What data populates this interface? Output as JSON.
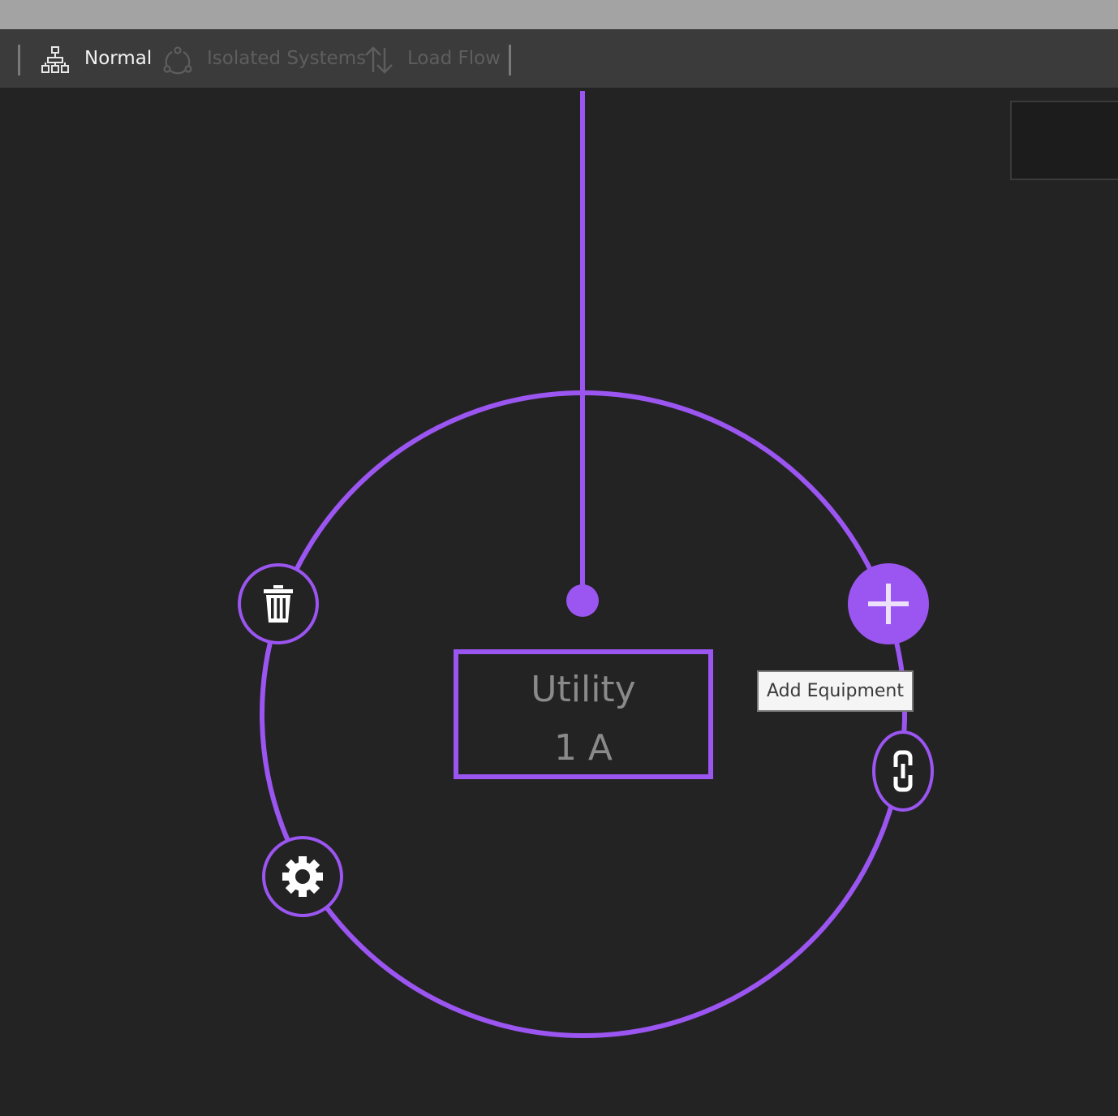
{
  "toolbar": {
    "modes": [
      {
        "label": "Normal",
        "icon": "hierarchy-icon",
        "state": "active"
      },
      {
        "label": "Isolated Systems",
        "icon": "cycle-icon",
        "state": "disabled"
      },
      {
        "label": "Load Flow",
        "icon": "up-down-arrows-icon",
        "state": "disabled"
      }
    ]
  },
  "node": {
    "name": "Utility",
    "value": "1 A"
  },
  "actions": {
    "delete_icon": "trash-icon",
    "settings_icon": "gear-icon",
    "add_icon": "plus-icon",
    "link_icon": "link-icon"
  },
  "tooltip": {
    "text": "Add Equipment"
  },
  "colors": {
    "accent": "#9b55f0",
    "background": "#232323",
    "toolbar": "#3b3b3b",
    "titlebar": "#a3a3a3"
  }
}
